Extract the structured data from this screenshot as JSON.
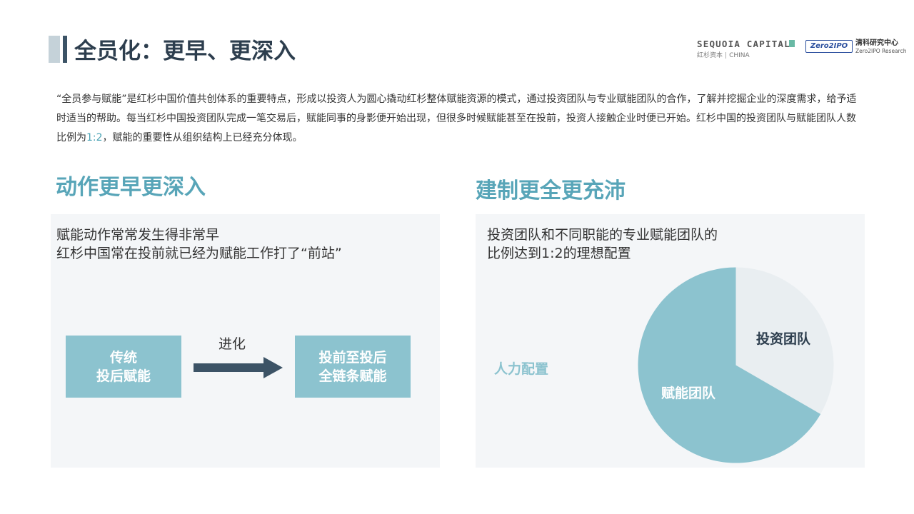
{
  "header": {
    "title": "全员化：更早、更深入",
    "logo_sequoia": {
      "name": "SEQUOIA CAPITAL",
      "cn": "红杉资本",
      "sub": "CHINA"
    },
    "logo_zero2ipo": {
      "mark": "Zero2IPO",
      "cn": "清科研究中心",
      "en": "Zero2IPO Research"
    }
  },
  "intro": {
    "before": "“全员参与赋能”是红杉中国价值共创体系的重要特点，形成以投资人为圆心撬动红杉整体赋能资源的模式，通过投资团队与专业赋能团队的合作，了解并挖掘企业的深度需求，给予适时适当的帮助。每当红杉中国投资团队完成一笔交易后，赋能同事的身影便开始出现，但很多时候赋能甚至在投前，投资人接触企业时便已开始。红杉中国的投资团队与赋能团队人数比例为",
    "ratio": "1:2",
    "after": "，赋能的重要性从组织结构上已经充分体现。"
  },
  "left": {
    "section_title": "动作更早更深入",
    "line1": "赋能动作常常发生得非常早",
    "line2": "红杉中国常在投前就已经为赋能工作打了“前站”",
    "box_from": {
      "line1": "传统",
      "line2": "投后赋能"
    },
    "arrow_label": "进化",
    "box_to": {
      "line1": "投前至投后",
      "line2": "全链条赋能"
    }
  },
  "right": {
    "section_title": "建制更全更充沛",
    "line1": "投资团队和不同职能的专业赋能团队的",
    "line2": "比例达到1:2的理想配置",
    "side_label": "人力配置"
  },
  "chart_data": {
    "type": "pie",
    "title": "",
    "categories": [
      "投资团队",
      "赋能团队"
    ],
    "values": [
      1,
      2
    ],
    "colors": [
      "#e9eef1",
      "#8cc3cf"
    ],
    "label_colors": [
      "#2d3e4e",
      "#ffffff"
    ],
    "legend": "none"
  },
  "colors": {
    "accent": "#58a5b8",
    "box": "#8cc3cf",
    "arrow": "#3c5366",
    "title": "#2d3e4e"
  }
}
